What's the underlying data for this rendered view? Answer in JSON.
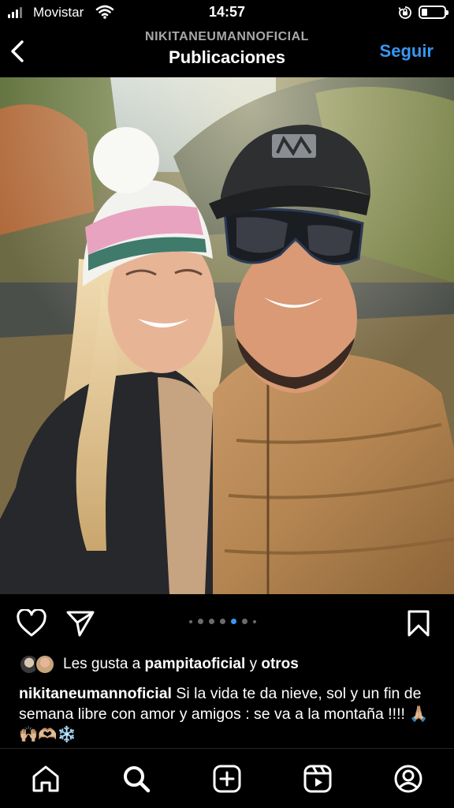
{
  "status_bar": {
    "carrier": "Movistar",
    "time": "14:57"
  },
  "header": {
    "username": "NIKITANEUMANNOFICIAL",
    "title": "Publicaciones",
    "follow_label": "Seguir"
  },
  "post": {
    "image_alt": "Selfie of a couple outdoors",
    "carousel": {
      "count": 6,
      "active_index": 3
    },
    "likes": {
      "prefix": "Les gusta a",
      "user": "pampitaoficial",
      "joiner": "y",
      "others": "otros"
    },
    "caption": {
      "user": "nikitaneumannoficial",
      "text": "Si la vida te da nieve, sol y un fin de semana libre con amor y amigos : se va a la montaña !!!! 🙏🏼🙌🏼🫶🏼❄️"
    }
  },
  "colors": {
    "accent": "#3897f0",
    "background": "#000000",
    "secondary_text": "#a8a8a8"
  },
  "icons": {
    "actions": [
      "heart-icon",
      "send-icon",
      "bookmark-icon"
    ],
    "nav": [
      "home-icon",
      "search-icon",
      "create-icon",
      "reels-icon",
      "profile-icon"
    ]
  }
}
